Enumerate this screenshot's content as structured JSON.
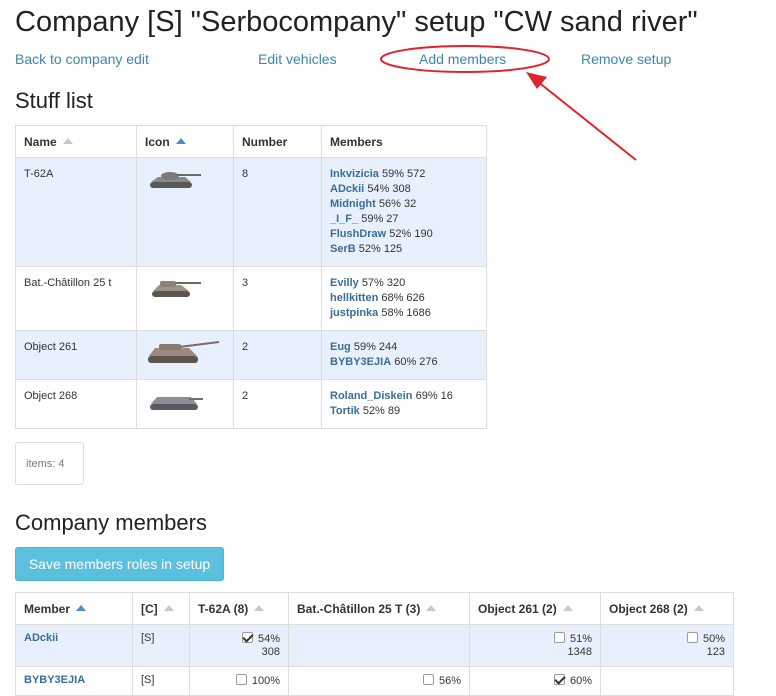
{
  "title": "Company [S] \"Serbocompany\" setup \"CW sand river\"",
  "links": {
    "back": "Back to company edit",
    "edit_vehicles": "Edit vehicles",
    "add_members": "Add members",
    "remove_setup": "Remove setup"
  },
  "stuff": {
    "heading": "Stuff list",
    "headers": {
      "name": "Name",
      "icon": "Icon",
      "number": "Number",
      "members": "Members"
    },
    "rows": [
      {
        "name": "T-62A",
        "number": "8",
        "members": [
          {
            "name": "Inkvizicia",
            "stat": "59% 572"
          },
          {
            "name": "ADckii",
            "stat": "54% 308"
          },
          {
            "name": "Midnight",
            "stat": "56% 32"
          },
          {
            "name": "_I_F_",
            "stat": "59% 27"
          },
          {
            "name": "FlushDraw",
            "stat": "52% 190"
          },
          {
            "name": "SerB",
            "stat": "52% 125"
          }
        ]
      },
      {
        "name": "Bat.-Châtillon 25 t",
        "number": "3",
        "members": [
          {
            "name": "Evilly",
            "stat": "57% 320"
          },
          {
            "name": "hellkitten",
            "stat": "68% 626"
          },
          {
            "name": "justpinka",
            "stat": "58% 1686"
          }
        ]
      },
      {
        "name": "Object 261",
        "number": "2",
        "members": [
          {
            "name": "Eug",
            "stat": "59% 244"
          },
          {
            "name": "BYBY3EJIA",
            "stat": "60% 276"
          }
        ]
      },
      {
        "name": "Object 268",
        "number": "2",
        "members": [
          {
            "name": "Roland_Diskein",
            "stat": "69% 16"
          },
          {
            "name": "Tortik",
            "stat": "52% 89"
          }
        ]
      }
    ],
    "items_count": "items: 4"
  },
  "company_members": {
    "heading": "Company members",
    "save_button": "Save members roles in setup",
    "headers": {
      "member": "Member",
      "role": "[C]",
      "t62a": "T-62A (8)",
      "bat": "Bat.-Châtillon 25 T (3)",
      "obj261": "Object 261 (2)",
      "obj268": "Object 268 (2)"
    },
    "rows": [
      {
        "member": "ADckii",
        "role": "[S]",
        "t62a": {
          "checked": true,
          "pct": "54%",
          "battles": "308"
        },
        "bat": null,
        "obj261": {
          "checked": false,
          "pct": "51%",
          "battles": "1348"
        },
        "obj268": {
          "checked": false,
          "pct": "50%",
          "battles": "123"
        }
      },
      {
        "member": "BYBY3EJIA",
        "role": "[S]",
        "t62a": {
          "checked": false,
          "pct": "100%",
          "battles": ""
        },
        "bat": {
          "checked": false,
          "pct": "56%",
          "battles": ""
        },
        "obj261": {
          "checked": true,
          "pct": "60%",
          "battles": ""
        },
        "obj268": null
      }
    ]
  },
  "colors": {
    "link": "#3a87ad",
    "member_link": "#3a6d97",
    "row_highlight": "#e8f0fd",
    "button": "#5bc0de",
    "annotation": "#e0242f"
  }
}
